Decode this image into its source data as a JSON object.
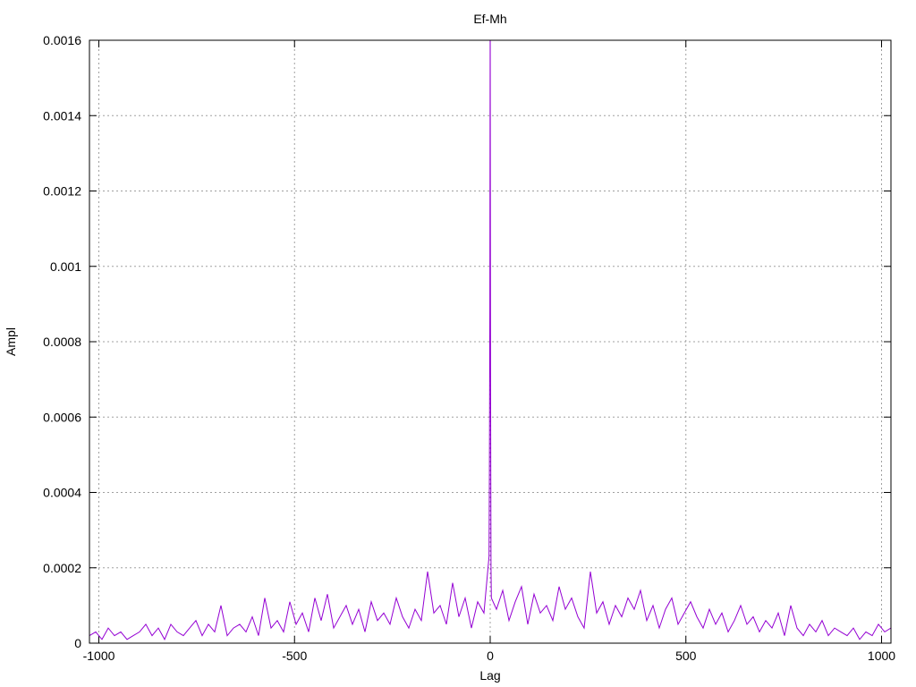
{
  "chart_data": {
    "type": "line",
    "title": "Ef-Mh",
    "xlabel": "Lag",
    "ylabel": "Ampl",
    "xlim": [
      -1024,
      1024
    ],
    "ylim": [
      0,
      0.0016
    ],
    "grid": true,
    "legend": "none",
    "xticks": [
      -1000,
      -500,
      0,
      500,
      1000
    ],
    "xtick_labels": [
      "-1000",
      "-500",
      "0",
      "500",
      "1000"
    ],
    "yticks": [
      0,
      0.0002,
      0.0004,
      0.0006,
      0.0008,
      0.001,
      0.0012,
      0.0014,
      0.0016
    ],
    "ytick_labels": [
      "0",
      "0.0002",
      "0.0004",
      "0.0006",
      "0.0008",
      "0.001",
      "0.0012",
      "0.0014",
      "0.0016"
    ],
    "series": [
      {
        "color": "#9400d3",
        "x": [
          -1024,
          -1008,
          -992,
          -976,
          -960,
          -944,
          -928,
          -912,
          -896,
          -880,
          -864,
          -848,
          -832,
          -816,
          -800,
          -784,
          -768,
          -752,
          -736,
          -720,
          -704,
          -688,
          -672,
          -656,
          -640,
          -624,
          -608,
          -592,
          -576,
          -560,
          -544,
          -528,
          -512,
          -496,
          -480,
          -464,
          -448,
          -432,
          -416,
          -400,
          -384,
          -368,
          -352,
          -336,
          -320,
          -304,
          -288,
          -272,
          -256,
          -240,
          -224,
          -208,
          -192,
          -176,
          -160,
          -144,
          -128,
          -112,
          -96,
          -80,
          -64,
          -48,
          -32,
          -16,
          -3,
          -2,
          -1,
          0,
          1,
          2,
          3,
          16,
          32,
          48,
          64,
          80,
          96,
          112,
          128,
          144,
          160,
          176,
          192,
          208,
          224,
          240,
          256,
          272,
          288,
          304,
          320,
          336,
          352,
          368,
          384,
          400,
          416,
          432,
          448,
          464,
          480,
          496,
          512,
          528,
          544,
          560,
          576,
          592,
          608,
          624,
          640,
          656,
          672,
          688,
          704,
          720,
          736,
          752,
          768,
          784,
          800,
          816,
          832,
          848,
          864,
          880,
          896,
          912,
          928,
          944,
          960,
          976,
          992,
          1008,
          1024
        ],
        "y": [
          2e-05,
          3e-05,
          1e-05,
          4e-05,
          2e-05,
          3e-05,
          1e-05,
          2e-05,
          3e-05,
          5e-05,
          2e-05,
          4e-05,
          1e-05,
          5e-05,
          3e-05,
          2e-05,
          4e-05,
          6e-05,
          2e-05,
          5e-05,
          3e-05,
          0.0001,
          2e-05,
          4e-05,
          5e-05,
          3e-05,
          7e-05,
          2e-05,
          0.00012,
          4e-05,
          6e-05,
          3e-05,
          0.00011,
          5e-05,
          8e-05,
          3e-05,
          0.00012,
          6e-05,
          0.00013,
          4e-05,
          7e-05,
          0.0001,
          5e-05,
          9e-05,
          3e-05,
          0.00011,
          6e-05,
          8e-05,
          5e-05,
          0.00012,
          7e-05,
          4e-05,
          9e-05,
          6e-05,
          0.00019,
          8e-05,
          0.0001,
          5e-05,
          0.00016,
          7e-05,
          0.00012,
          4e-05,
          0.00011,
          8e-05,
          0.00023,
          0.00045,
          0.00089,
          0.0017,
          0.00073,
          0.0002,
          0.00012,
          9e-05,
          0.00014,
          6e-05,
          0.00011,
          0.00015,
          5e-05,
          0.00013,
          8e-05,
          0.0001,
          6e-05,
          0.00015,
          9e-05,
          0.00012,
          7e-05,
          4e-05,
          0.00019,
          8e-05,
          0.00011,
          5e-05,
          0.0001,
          7e-05,
          0.00012,
          9e-05,
          0.00014,
          6e-05,
          0.0001,
          4e-05,
          9e-05,
          0.00012,
          5e-05,
          8e-05,
          0.00011,
          7e-05,
          4e-05,
          9e-05,
          5e-05,
          8e-05,
          3e-05,
          6e-05,
          0.0001,
          5e-05,
          7e-05,
          3e-05,
          6e-05,
          4e-05,
          8e-05,
          2e-05,
          0.0001,
          4e-05,
          2e-05,
          5e-05,
          3e-05,
          6e-05,
          2e-05,
          4e-05,
          3e-05,
          2e-05,
          4e-05,
          1e-05,
          3e-05,
          2e-05,
          5e-05,
          3e-05,
          4e-05
        ]
      }
    ]
  }
}
